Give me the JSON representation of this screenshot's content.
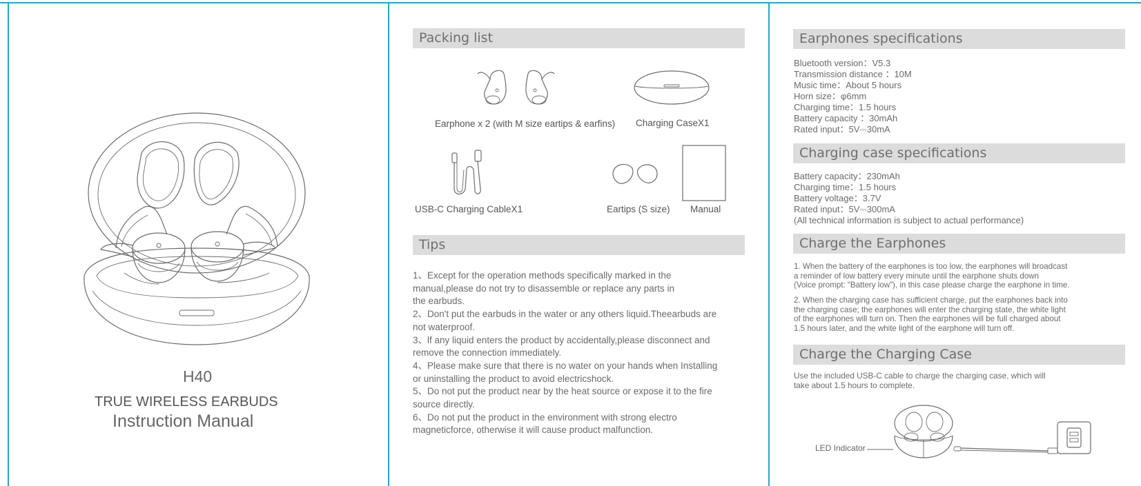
{
  "cover": {
    "model": "H40",
    "product": "TRUE WIRELESS EARBUDS",
    "manual": "Instruction Manual"
  },
  "packing": {
    "title": "Packing list",
    "items": [
      {
        "label": "Earphone x 2 (with M size eartips & earfins)"
      },
      {
        "label": "Charging CaseX1"
      },
      {
        "label": "USB-C Charging CableX1"
      },
      {
        "label": "Eartips (S size)"
      },
      {
        "label": "Manual"
      }
    ]
  },
  "tips": {
    "title": "Tips",
    "lines": [
      "1、Except for the operation methods specifically marked in the",
      "manual,please do not try to disassemble or replace any parts in",
      "the earbuds.",
      "2、Don't put the earbuds in the water or any others liquid.Theearbuds are",
      "not waterproof.",
      "3、lf any liquid enters the product by accidentally,please disconnect and",
      "remove the connection immediately.",
      "4、Please make sure that there is no water on your hands when Installing",
      "or uninstalling the product to avoid electricshock.",
      "5、Do not put the product near by the heat source or expose it to the fire",
      "source directly.",
      "6、Do not put the product in the environment with strong electro",
      "magneticforce, otherwise it will cause product malfunction."
    ]
  },
  "earphone_specs": {
    "title": "Earphones specifications",
    "lines": [
      "Bluetooth version：V5.3",
      "Transmission distance ：10M",
      "Music time：About 5 hours",
      "Horn size：φ6mm",
      "Charging time：1.5 hours",
      "Battery capacity ：30mAh",
      "Rated input：5V⎓30mA"
    ]
  },
  "case_specs": {
    "title": "Charging case specifications",
    "lines": [
      "Battery capacity：230mAh",
      "Charging time：1.5 hours",
      "Battery voltage：3.7V",
      "Rated input：5V⎓300mA",
      "(All technical information is subject to actual performance)"
    ]
  },
  "charge_earphones": {
    "title": "Charge the Earphones",
    "p1": [
      "1. When the battery of the earphones is too low, the earphones will broadcast",
      "a reminder of low battery every minute until the earphone shuts down",
      "(Voice prompt: “Battery low”), in this case please charge the earphone in time."
    ],
    "p2": [
      "2. When the charging case has sufficient charge, put the earphones back into",
      " the charging case; the earphones will enter the charging state, the white light",
      " of the earphones will turn on. Then the earphones will be full charged about",
      "1.5 hours later, and the white light of the earphone will turn off."
    ]
  },
  "charge_case": {
    "title": "Charge the Charging Case",
    "lines": [
      "Use the included USB-C cable to charge the charging case, which will",
      "take about 1.5 hours to complete."
    ],
    "led_label": "LED Indicator"
  },
  "colors": {
    "rule": "#27a6c8",
    "header_bg": "#dcdcdc",
    "text": "#666666"
  },
  "icons": [
    "earbuds-case-illustration",
    "earphone-pair-icon",
    "charging-case-icon",
    "usb-c-cable-icon",
    "eartips-icon",
    "manual-icon",
    "charging-diagram",
    "usb-adapter-icon"
  ]
}
